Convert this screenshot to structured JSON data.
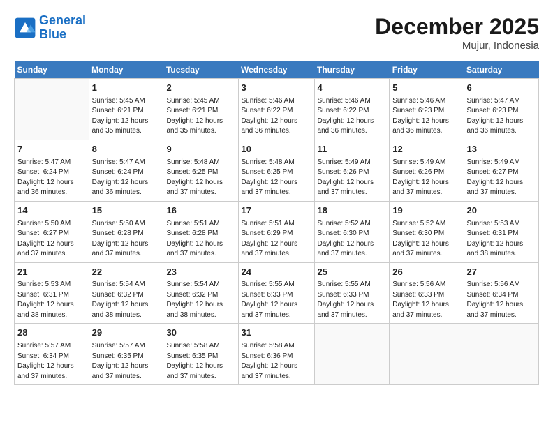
{
  "header": {
    "logo_line1": "General",
    "logo_line2": "Blue",
    "month": "December 2025",
    "location": "Mujur, Indonesia"
  },
  "days_of_week": [
    "Sunday",
    "Monday",
    "Tuesday",
    "Wednesday",
    "Thursday",
    "Friday",
    "Saturday"
  ],
  "weeks": [
    [
      {
        "day": "",
        "content": ""
      },
      {
        "day": "1",
        "content": "Sunrise: 5:45 AM\nSunset: 6:21 PM\nDaylight: 12 hours\nand 35 minutes."
      },
      {
        "day": "2",
        "content": "Sunrise: 5:45 AM\nSunset: 6:21 PM\nDaylight: 12 hours\nand 35 minutes."
      },
      {
        "day": "3",
        "content": "Sunrise: 5:46 AM\nSunset: 6:22 PM\nDaylight: 12 hours\nand 36 minutes."
      },
      {
        "day": "4",
        "content": "Sunrise: 5:46 AM\nSunset: 6:22 PM\nDaylight: 12 hours\nand 36 minutes."
      },
      {
        "day": "5",
        "content": "Sunrise: 5:46 AM\nSunset: 6:23 PM\nDaylight: 12 hours\nand 36 minutes."
      },
      {
        "day": "6",
        "content": "Sunrise: 5:47 AM\nSunset: 6:23 PM\nDaylight: 12 hours\nand 36 minutes."
      }
    ],
    [
      {
        "day": "7",
        "content": "Sunrise: 5:47 AM\nSunset: 6:24 PM\nDaylight: 12 hours\nand 36 minutes."
      },
      {
        "day": "8",
        "content": "Sunrise: 5:47 AM\nSunset: 6:24 PM\nDaylight: 12 hours\nand 36 minutes."
      },
      {
        "day": "9",
        "content": "Sunrise: 5:48 AM\nSunset: 6:25 PM\nDaylight: 12 hours\nand 37 minutes."
      },
      {
        "day": "10",
        "content": "Sunrise: 5:48 AM\nSunset: 6:25 PM\nDaylight: 12 hours\nand 37 minutes."
      },
      {
        "day": "11",
        "content": "Sunrise: 5:49 AM\nSunset: 6:26 PM\nDaylight: 12 hours\nand 37 minutes."
      },
      {
        "day": "12",
        "content": "Sunrise: 5:49 AM\nSunset: 6:26 PM\nDaylight: 12 hours\nand 37 minutes."
      },
      {
        "day": "13",
        "content": "Sunrise: 5:49 AM\nSunset: 6:27 PM\nDaylight: 12 hours\nand 37 minutes."
      }
    ],
    [
      {
        "day": "14",
        "content": "Sunrise: 5:50 AM\nSunset: 6:27 PM\nDaylight: 12 hours\nand 37 minutes."
      },
      {
        "day": "15",
        "content": "Sunrise: 5:50 AM\nSunset: 6:28 PM\nDaylight: 12 hours\nand 37 minutes."
      },
      {
        "day": "16",
        "content": "Sunrise: 5:51 AM\nSunset: 6:28 PM\nDaylight: 12 hours\nand 37 minutes."
      },
      {
        "day": "17",
        "content": "Sunrise: 5:51 AM\nSunset: 6:29 PM\nDaylight: 12 hours\nand 37 minutes."
      },
      {
        "day": "18",
        "content": "Sunrise: 5:52 AM\nSunset: 6:30 PM\nDaylight: 12 hours\nand 37 minutes."
      },
      {
        "day": "19",
        "content": "Sunrise: 5:52 AM\nSunset: 6:30 PM\nDaylight: 12 hours\nand 37 minutes."
      },
      {
        "day": "20",
        "content": "Sunrise: 5:53 AM\nSunset: 6:31 PM\nDaylight: 12 hours\nand 38 minutes."
      }
    ],
    [
      {
        "day": "21",
        "content": "Sunrise: 5:53 AM\nSunset: 6:31 PM\nDaylight: 12 hours\nand 38 minutes."
      },
      {
        "day": "22",
        "content": "Sunrise: 5:54 AM\nSunset: 6:32 PM\nDaylight: 12 hours\nand 38 minutes."
      },
      {
        "day": "23",
        "content": "Sunrise: 5:54 AM\nSunset: 6:32 PM\nDaylight: 12 hours\nand 38 minutes."
      },
      {
        "day": "24",
        "content": "Sunrise: 5:55 AM\nSunset: 6:33 PM\nDaylight: 12 hours\nand 37 minutes."
      },
      {
        "day": "25",
        "content": "Sunrise: 5:55 AM\nSunset: 6:33 PM\nDaylight: 12 hours\nand 37 minutes."
      },
      {
        "day": "26",
        "content": "Sunrise: 5:56 AM\nSunset: 6:33 PM\nDaylight: 12 hours\nand 37 minutes."
      },
      {
        "day": "27",
        "content": "Sunrise: 5:56 AM\nSunset: 6:34 PM\nDaylight: 12 hours\nand 37 minutes."
      }
    ],
    [
      {
        "day": "28",
        "content": "Sunrise: 5:57 AM\nSunset: 6:34 PM\nDaylight: 12 hours\nand 37 minutes."
      },
      {
        "day": "29",
        "content": "Sunrise: 5:57 AM\nSunset: 6:35 PM\nDaylight: 12 hours\nand 37 minutes."
      },
      {
        "day": "30",
        "content": "Sunrise: 5:58 AM\nSunset: 6:35 PM\nDaylight: 12 hours\nand 37 minutes."
      },
      {
        "day": "31",
        "content": "Sunrise: 5:58 AM\nSunset: 6:36 PM\nDaylight: 12 hours\nand 37 minutes."
      },
      {
        "day": "",
        "content": ""
      },
      {
        "day": "",
        "content": ""
      },
      {
        "day": "",
        "content": ""
      }
    ]
  ]
}
